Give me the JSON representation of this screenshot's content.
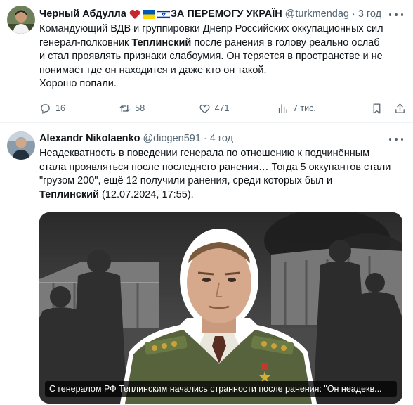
{
  "tweet1": {
    "name": "Черный Абдулла",
    "name_suffix": "ЗА ПЕРЕМОГУ УКРАЇН",
    "handle": "@turkmendag",
    "time": "3 год",
    "line1": "Командующий ВДВ и группировки Днепр Российских оккупационных сил",
    "line2_pre": "генерал-полковник ",
    "line2_bold": "Теплинский",
    "line2_post": " после ранения в голову реально ослаб",
    "line3": "и стал проявлять признаки слабоумия. Он теряется в пространстве и не",
    "line4": "понимает где он находится и даже кто он такой.",
    "line5": "Хорошо попали.",
    "replies": "16",
    "retweets": "58",
    "likes": "471",
    "views": "7 тис."
  },
  "tweet2": {
    "name": "Alexandr Nikolaenko",
    "handle": "@diogen591",
    "time": "4 год",
    "line1": "Неадекватность в поведении генерала по отношению к подчинённым",
    "line2": "стала проявляться после последнего ранения… Тогда 5 оккупантов стали",
    "line3": "\"грузом 200\", ещё 12 получили ранения, среди которых был и",
    "line4_bold": "Теплинский",
    "line4_post": " (12.07.2024, 17:55).",
    "media_caption": "С генералом РФ Теплинским начались странности после ранения: \"Он неадекв..."
  },
  "colors": {
    "text": "#0f1419",
    "secondary": "#536471",
    "heart": "#c7262e",
    "divider": "#eff3f4"
  },
  "icons": [
    "reply-icon",
    "retweet-icon",
    "like-icon",
    "views-icon",
    "bookmark-icon",
    "share-icon",
    "more-icon",
    "heart-emoji",
    "ukraine-flag-icon",
    "israel-flag-icon"
  ]
}
